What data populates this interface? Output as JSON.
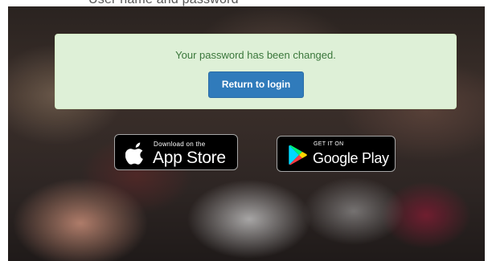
{
  "header": {
    "cut_text": "User name and password"
  },
  "alert": {
    "message": "Your password has been changed.",
    "button_label": "Return to login"
  },
  "badges": {
    "app_store": {
      "small_text": "Download on the",
      "big_text": "App Store",
      "icon": "apple-icon"
    },
    "google_play": {
      "small_text": "GET IT ON",
      "big_text": "Google Play",
      "icon": "google-play-icon"
    }
  },
  "colors": {
    "alert_background": "#dff0d8",
    "alert_text": "#3c763d",
    "primary_button": "#337ab7",
    "badge_background": "#000000"
  }
}
